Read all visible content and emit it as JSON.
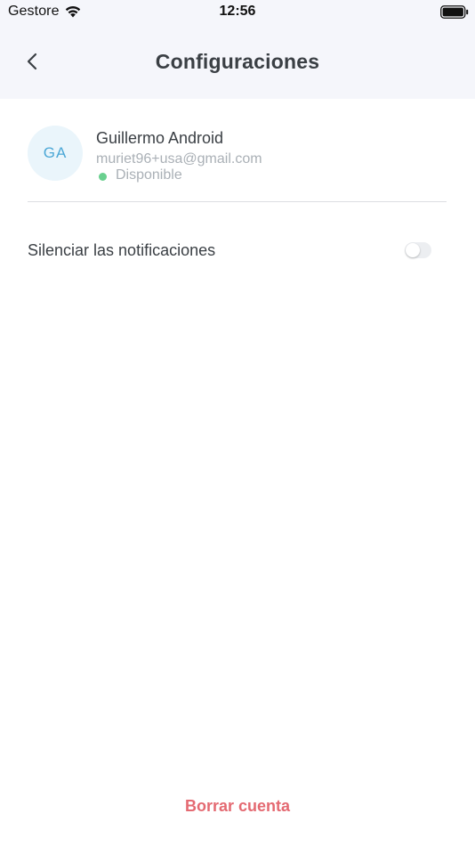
{
  "status_bar": {
    "carrier": "Gestore",
    "time": "12:56",
    "icons": [
      "wifi-icon",
      "battery-icon"
    ]
  },
  "header": {
    "title": "Configuraciones",
    "back_icon": "chevron-left-icon"
  },
  "profile": {
    "initials": "GA",
    "name": "Guillermo Android",
    "email": "muriet96+usa@gmail.com",
    "status": "Disponible",
    "status_color": "#6ad08f"
  },
  "settings": {
    "mute_notifications_label": "Silenciar las notificaciones",
    "mute_notifications_on": false
  },
  "footer": {
    "delete_account_label": "Borrar cuenta",
    "delete_color": "#e46a72"
  },
  "colors": {
    "header_bg": "#f5f6fb",
    "avatar_bg": "#eaf5fb",
    "avatar_text": "#4ba7d6"
  }
}
